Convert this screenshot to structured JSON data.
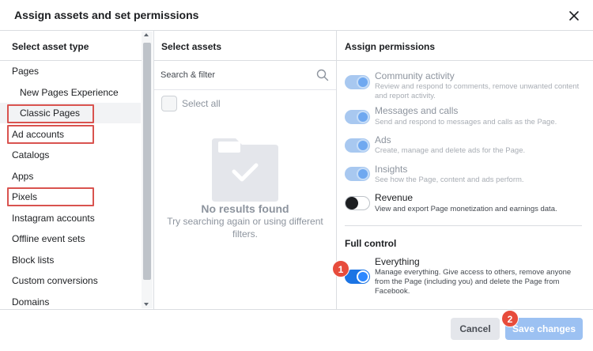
{
  "dialog": {
    "title": "Assign assets and set permissions",
    "close_icon": "close-icon"
  },
  "asset_type": {
    "header": "Select asset type",
    "items": [
      {
        "label": "Pages",
        "sub": false
      },
      {
        "label": "New Pages Experience",
        "sub": true
      },
      {
        "label": "Classic Pages",
        "sub": true,
        "selected": true,
        "highlighted": true
      },
      {
        "label": "Ad accounts",
        "sub": false,
        "highlighted": true
      },
      {
        "label": "Catalogs",
        "sub": false
      },
      {
        "label": "Apps",
        "sub": false
      },
      {
        "label": "Pixels",
        "sub": false,
        "highlighted": true
      },
      {
        "label": "Instagram accounts",
        "sub": false
      },
      {
        "label": "Offline event sets",
        "sub": false
      },
      {
        "label": "Block lists",
        "sub": false
      },
      {
        "label": "Custom conversions",
        "sub": false
      },
      {
        "label": "Domains",
        "sub": false
      }
    ]
  },
  "assets": {
    "header": "Select assets",
    "search_placeholder": "Search & filter",
    "select_all": "Select all",
    "empty_title": "No results found",
    "empty_subtitle": "Try searching again or using different filters."
  },
  "permissions": {
    "header": "Assign permissions",
    "items": [
      {
        "title": "Community activity",
        "desc": "Review and respond to comments, remove unwanted content and report activity.",
        "state": "on",
        "disabled": true
      },
      {
        "title": "Messages and calls",
        "desc": "Send and respond to messages and calls as the Page.",
        "state": "on",
        "disabled": true
      },
      {
        "title": "Ads",
        "desc": "Create, manage and delete ads for the Page.",
        "state": "on",
        "disabled": true
      },
      {
        "title": "Insights",
        "desc": "See how the Page, content and ads perform.",
        "state": "on",
        "disabled": true
      },
      {
        "title": "Revenue",
        "desc": "View and export Page monetization and earnings data.",
        "state": "off",
        "disabled": false
      }
    ],
    "full_control_label": "Full control",
    "everything": {
      "title": "Everything",
      "desc": "Manage everything. Give access to others, remove anyone from the Page (including you) and delete the Page from Facebook.",
      "state": "on"
    }
  },
  "badges": [
    "1",
    "2"
  ],
  "footer": {
    "cancel_label": "Cancel",
    "save_label": "Save changes"
  },
  "colors": {
    "accent": "#1b74e4",
    "highlight": "#d9534f",
    "badge": "#e74c3c"
  }
}
